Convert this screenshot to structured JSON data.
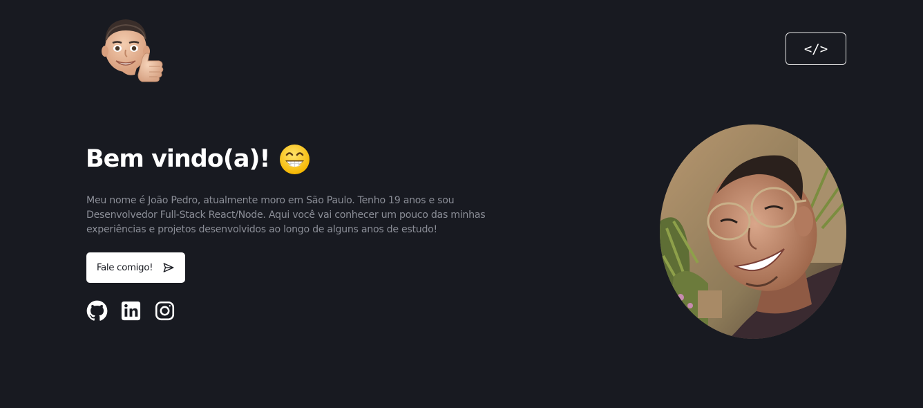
{
  "header": {
    "logo_icon": "memoji-thumbs-up-icon",
    "code_button_label": "</>"
  },
  "hero": {
    "title": "Bem vindo(a)!",
    "title_emoji": "grinning-face-icon",
    "intro": "Meu nome é João Pedro, atualmente moro em São Paulo. Tenho 19 anos e sou Desenvolvedor Full-Stack React/Node. Aqui você vai conhecer um pouco das minhas experiências e projetos desenvolvidos ao longo de alguns anos de estudo!",
    "contact_button_label": "Fale comigo!",
    "contact_button_icon": "send-icon"
  },
  "socials": [
    {
      "icon": "github-icon"
    },
    {
      "icon": "linkedin-icon"
    },
    {
      "icon": "instagram-icon"
    }
  ],
  "portrait": {
    "icon": "profile-photo"
  },
  "colors": {
    "background": "#181a21",
    "text": "#ffffff",
    "muted_text": "#8a8d96",
    "button_bg": "#ffffff"
  }
}
